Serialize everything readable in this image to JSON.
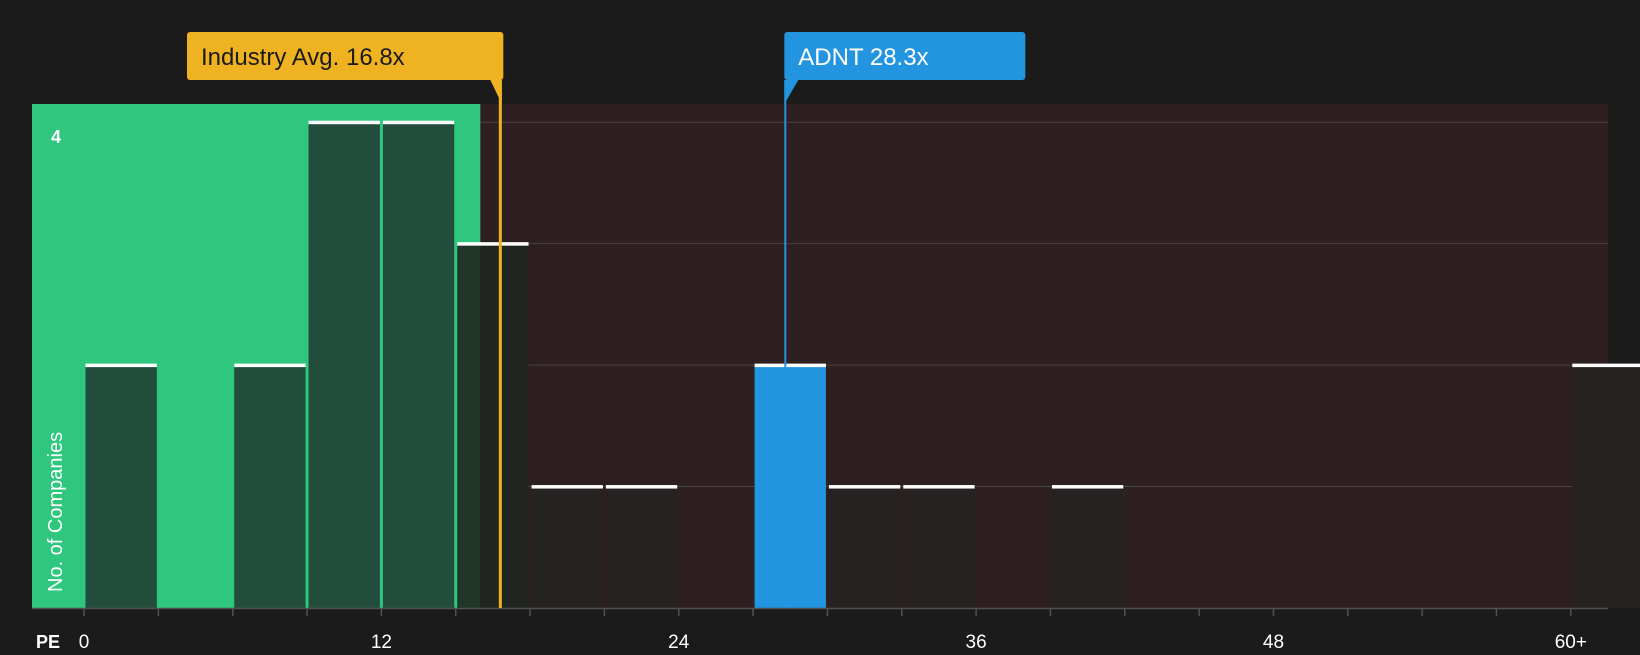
{
  "chart_data": {
    "type": "bar",
    "title": "",
    "xlabel": "PE",
    "ylabel": "No. of Companies",
    "x_ticks": [
      "0",
      "12",
      "24",
      "36",
      "48",
      "60+"
    ],
    "x_tick_values": [
      0,
      12,
      24,
      36,
      48,
      60
    ],
    "xlim": [
      -2.1,
      61.5
    ],
    "ylim": [
      0,
      4.15
    ],
    "y_tick_labels": [
      {
        "value": 4,
        "label": "4"
      }
    ],
    "gridlines": [
      1,
      2,
      3,
      4
    ],
    "bin_width": 3,
    "bins": [
      {
        "start": 0,
        "count": 2
      },
      {
        "start": 3,
        "count": 0
      },
      {
        "start": 6,
        "count": 2
      },
      {
        "start": 9,
        "count": 4
      },
      {
        "start": 12,
        "count": 4
      },
      {
        "start": 15,
        "count": 3
      },
      {
        "start": 18,
        "count": 1
      },
      {
        "start": 21,
        "count": 1
      },
      {
        "start": 24,
        "count": 0
      },
      {
        "start": 27,
        "count": 2,
        "highlight": true
      },
      {
        "start": 30,
        "count": 1
      },
      {
        "start": 33,
        "count": 1
      },
      {
        "start": 36,
        "count": 0
      },
      {
        "start": 39,
        "count": 1
      },
      {
        "start": 42,
        "count": 0
      },
      {
        "start": 45,
        "count": 0
      },
      {
        "start": 48,
        "count": 0
      },
      {
        "start": 51,
        "count": 0
      },
      {
        "start": 54,
        "count": 0
      },
      {
        "start": 57,
        "count": 0
      },
      {
        "start": 60,
        "count": 2
      }
    ],
    "markers": [
      {
        "name": "industry-avg",
        "label": "Industry Avg. 16.8x",
        "value": 16.8,
        "color": "#efb220"
      },
      {
        "name": "company",
        "label": "ADNT 28.3x",
        "value": 28.3,
        "color": "#2394e0"
      }
    ],
    "colors": {
      "background": "#1b1b1b",
      "good_zone": "#2ec77d",
      "bad_zone": "#2e1f20",
      "bar_in_good_zone": "#22473a",
      "bar_default": "#262222",
      "bar_highlight": "#2394e0",
      "bar_top": "#ffffff",
      "grid": "#4a4242",
      "tick_label": "#ffffff",
      "axis_line": "#55504e",
      "marker_text_dark": "#1b1b1b",
      "marker_text_light": "#ffffff"
    }
  }
}
